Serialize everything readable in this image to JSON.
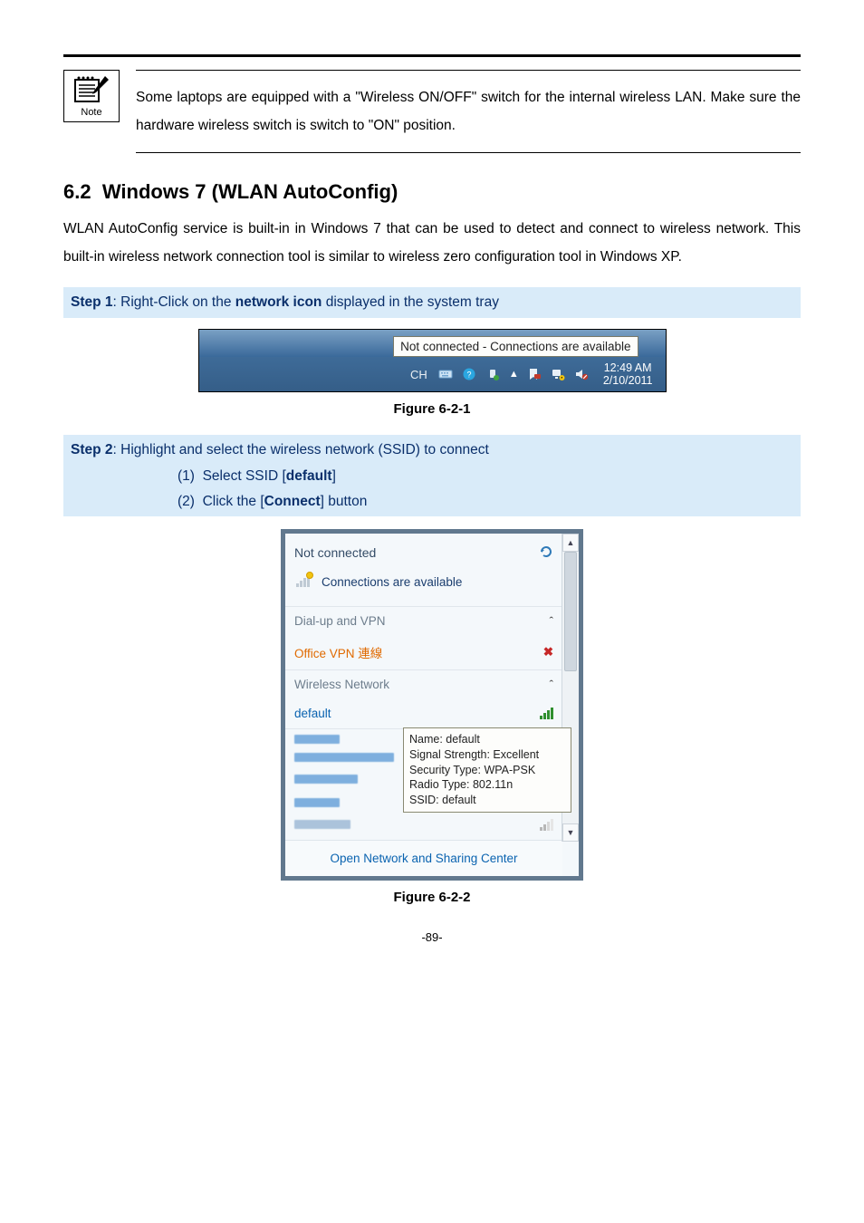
{
  "note": {
    "label": "Note",
    "text": "Some laptops are equipped with a \"Wireless ON/OFF\" switch for the internal wireless LAN. Make sure the hardware wireless switch is switch to \"ON\" position."
  },
  "heading": {
    "num": "6.2",
    "title": "Windows 7 (WLAN AutoConfig)"
  },
  "intro": "WLAN AutoConfig service is built-in in Windows 7 that can be used to detect and connect to wireless network. This built-in wireless network connection tool is similar to wireless zero configuration tool in Windows XP.",
  "step1": {
    "label": "Step 1",
    "sep": ": ",
    "pre": "Right-Click on the ",
    "bold": "network icon",
    "post": " displayed in the system tray"
  },
  "fig1": {
    "tooltip": "Not connected - Connections are available",
    "lang": "CH",
    "time": "12:49 AM",
    "date": "2/10/2011",
    "caption": "Figure 6-2-1",
    "icons": [
      "keyboard-icon",
      "help-icon",
      "usb-eject-icon",
      "show-hidden-icon",
      "action-center-icon",
      "network-icon",
      "volume-icon"
    ]
  },
  "step2": {
    "label": "Step 2",
    "sep": ": ",
    "text": "Highlight and select the wireless network (SSID) to connect",
    "items": [
      {
        "idx": "(1)",
        "pre": "Select SSID [",
        "bold": "default",
        "post": "]"
      },
      {
        "idx": "(2)",
        "pre": "Click the [",
        "bold": "Connect",
        "post": "] button"
      }
    ]
  },
  "fig2": {
    "header": "Not connected",
    "avail": "Connections are available",
    "dial_section": "Dial-up and VPN",
    "vpn_item": "Office VPN 連線",
    "wlan_section": "Wireless Network",
    "ssid_selected": "default",
    "tooltip": {
      "l1": "Name: default",
      "l2": "Signal Strength: Excellent",
      "l3": "Security Type: WPA-PSK",
      "l4": "Radio Type: 802.11n",
      "l5": "SSID: default"
    },
    "footer": "Open Network and Sharing Center",
    "caption": "Figure 6-2-2"
  },
  "pagenum": "-89-"
}
